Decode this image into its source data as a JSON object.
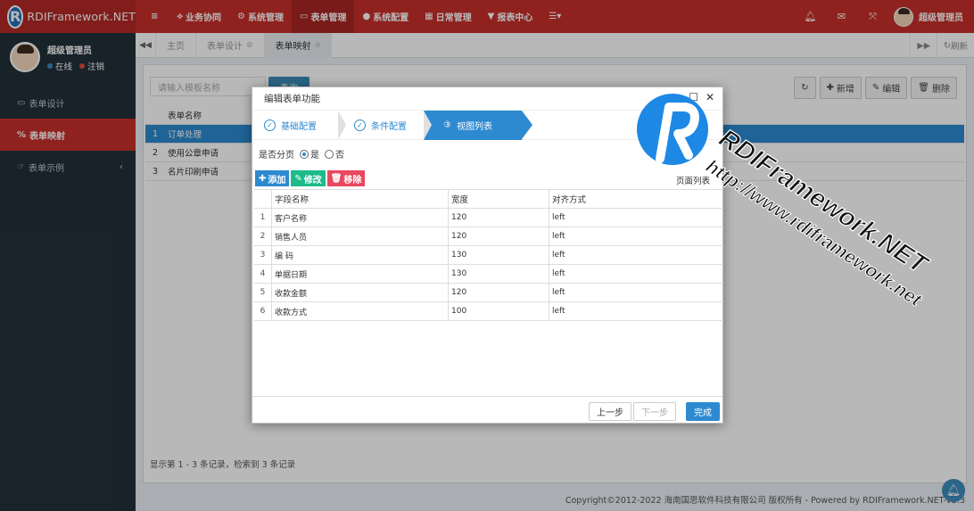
{
  "brand": {
    "name": "RDIFramework.NET",
    "logo_letter": "R"
  },
  "topnav": [
    {
      "icon": "menu-icon",
      "glyph": "≡",
      "label": ""
    },
    {
      "icon": "share-icon",
      "glyph": "⟡",
      "label": "业务协同"
    },
    {
      "icon": "gears-icon",
      "glyph": "⚙",
      "label": "系统管理"
    },
    {
      "icon": "form-icon",
      "glyph": "▭",
      "label": "表单管理"
    },
    {
      "icon": "circle-icon",
      "glyph": "●",
      "label": "系统配置"
    },
    {
      "icon": "calendar-icon",
      "glyph": "▦",
      "label": "日常管理"
    },
    {
      "icon": "filter-icon",
      "glyph": "▼",
      "label": "报表中心"
    },
    {
      "icon": "list-icon",
      "glyph": "☰▾",
      "label": ""
    }
  ],
  "topright": {
    "user_name": "超级管理员"
  },
  "sidebar": {
    "user_name": "超级管理员",
    "status_online": "在线",
    "status_logout": "注销",
    "online_color": "#3c8dbc",
    "logout_color": "#dd4b39",
    "items": [
      {
        "label": "表单设计",
        "glyph": "▭"
      },
      {
        "label": "表单映射",
        "glyph": "%"
      },
      {
        "label": "表单示例",
        "glyph": "☞",
        "chevron": "‹"
      }
    ]
  },
  "tabs": {
    "items": [
      {
        "label": "主页"
      },
      {
        "label": "表单设计"
      },
      {
        "label": "表单映射"
      }
    ],
    "refresh_label": "刷新"
  },
  "content": {
    "search_placeholder": "请输入模板名称",
    "search_button": "查询",
    "tools": [
      "",
      "新增",
      "编辑",
      "删除"
    ],
    "column_header": "表单名称",
    "rows": [
      {
        "n": "1",
        "name": "订单处理"
      },
      {
        "n": "2",
        "name": "使用公章申请"
      },
      {
        "n": "3",
        "name": "名片印刷申请"
      }
    ],
    "footer": "显示第 1 - 3 条记录，检索到 3 条记录",
    "copyright": "Copyright©2012-2022 海南国思软件科技有限公司 版权所有 - Powered by RDIFramework.NET-V5.3"
  },
  "modal": {
    "title": "编辑表单功能",
    "steps": [
      {
        "marker": "✓",
        "label": "基础配置"
      },
      {
        "marker": "✓",
        "label": "条件配置"
      },
      {
        "marker": "③",
        "label": "视图列表"
      }
    ],
    "paging_label": "是否分页",
    "paging_yes": "是",
    "paging_no": "否",
    "btn_add": "添加",
    "btn_edit": "修改",
    "btn_remove": "移除",
    "page_tab_label": "页面列表",
    "grid_headers": [
      "字段名称",
      "宽度",
      "对齐方式"
    ],
    "grid_rows": [
      {
        "n": "1",
        "name": "客户名称",
        "width": "120",
        "align": "left"
      },
      {
        "n": "2",
        "name": "销售人员",
        "width": "120",
        "align": "left"
      },
      {
        "n": "3",
        "name": "编 码",
        "width": "130",
        "align": "left"
      },
      {
        "n": "4",
        "name": "单据日期",
        "width": "130",
        "align": "left"
      },
      {
        "n": "5",
        "name": "收款金额",
        "width": "120",
        "align": "left"
      },
      {
        "n": "6",
        "name": "收款方式",
        "width": "100",
        "align": "left"
      }
    ],
    "btn_prev": "上一步",
    "btn_next": "下一步",
    "btn_finish": "完成"
  },
  "watermark": {
    "line1": "RDIFramework.NET",
    "line2": "http://www.rdiframework.net"
  }
}
